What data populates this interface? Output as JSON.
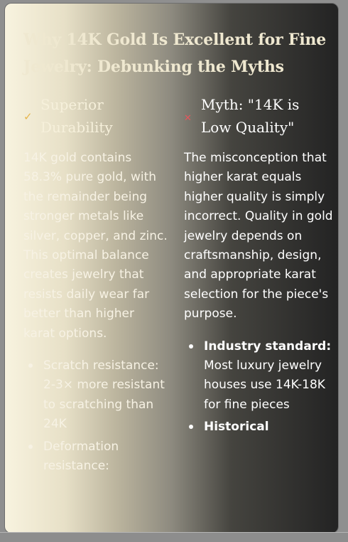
{
  "title": "Why 14K Gold Is Excellent for Fine Jewelry: Debunking the Myths",
  "left": {
    "icon": "check-icon",
    "icon_glyph": "✓",
    "heading": "Superior Durability",
    "paragraph": "14K gold contains 58.3% pure gold, with the remainder being stronger metals like silver, copper, and zinc. This optimal balance creates jewelry that resists daily wear far better than higher karat options.",
    "bullets": [
      {
        "label": "",
        "text": "Scratch resistance: 2-3× more resistant to scratching than 24K"
      },
      {
        "label": "",
        "text": "Deformation resistance:"
      }
    ]
  },
  "right": {
    "icon": "x-mark-icon",
    "icon_glyph": "✕",
    "heading": "Myth: \"14K is Low Quality\"",
    "paragraph": "The misconception that higher karat equals higher quality is simply incorrect. Quality in gold jewelry depends on craftsmanship, design, and appropriate karat selection for the piece's purpose.",
    "bullets": [
      {
        "label": "Industry standard:",
        "text": " Most luxury jewelry houses use 14K-18K for fine pieces"
      },
      {
        "label": "Historical",
        "text": ""
      }
    ]
  },
  "colors": {
    "accent_gold": "#e6b64c",
    "myth_red": "#e4575d",
    "card_dark": "#232323",
    "card_light": "#f8f3df"
  }
}
